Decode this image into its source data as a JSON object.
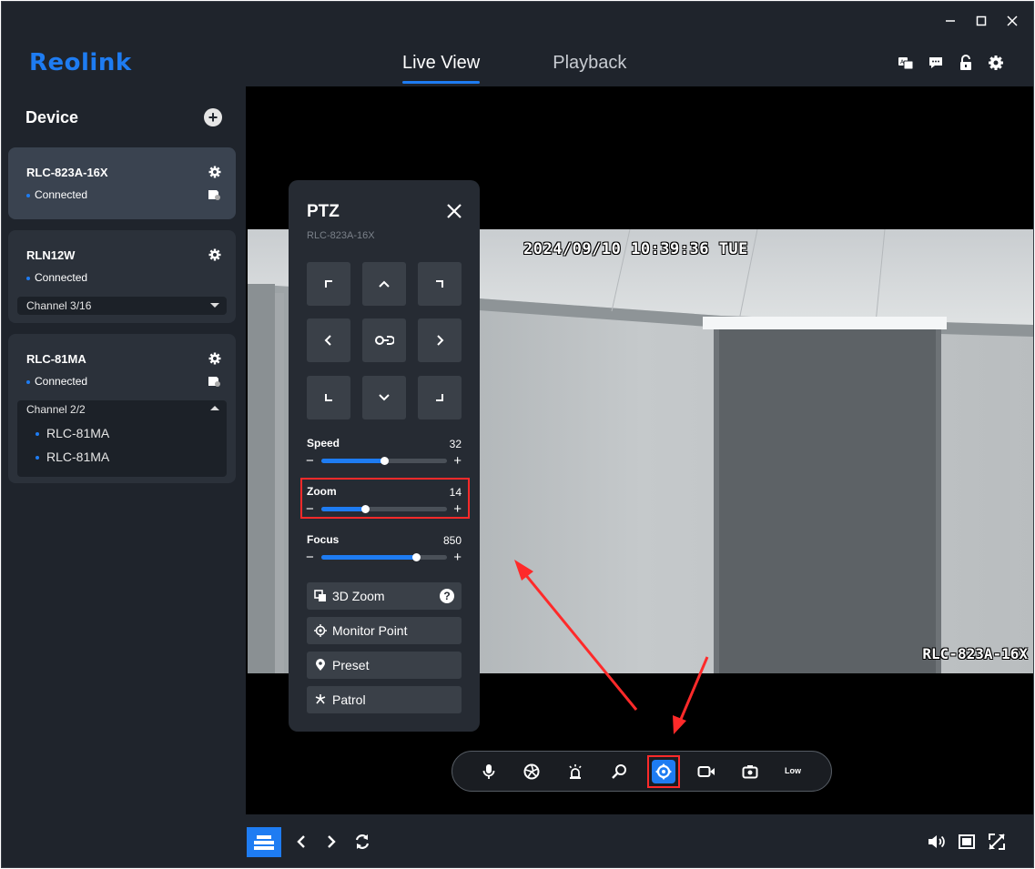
{
  "header": {
    "logo": "Reolink",
    "tabs": [
      {
        "label": "Live View",
        "active": true
      },
      {
        "label": "Playback",
        "active": false
      }
    ],
    "window_controls": [
      "minimize-icon",
      "maximize-icon",
      "close-icon"
    ],
    "icons": [
      "translate-icon",
      "message-icon",
      "unlock-icon",
      "gear-icon"
    ]
  },
  "sidebar": {
    "title": "Device",
    "devices": [
      {
        "name": "RLC-823A-16X",
        "status": "Connected",
        "active": true
      },
      {
        "name": "RLN12W",
        "status": "Connected",
        "channel": "Channel 3/16"
      },
      {
        "name": "RLC-81MA",
        "status": "Connected",
        "channel": "Channel 2/2",
        "channels": [
          "RLC-81MA",
          "RLC-81MA"
        ]
      }
    ]
  },
  "video": {
    "timestamp": "2024/09/10 10:39:36 TUE",
    "camera_name": "RLC-823A-16X"
  },
  "ptz": {
    "title": "PTZ",
    "device": "RLC-823A-16X",
    "speed": {
      "label": "Speed",
      "value": "32",
      "fraction": 0.5
    },
    "zoom": {
      "label": "Zoom",
      "value": "14",
      "fraction": 0.35
    },
    "focus": {
      "label": "Focus",
      "value": "850",
      "fraction": 0.75
    },
    "buttons": {
      "zoom3d": "3D Zoom",
      "monitor": "Monitor Point",
      "preset": "Preset",
      "patrol": "Patrol"
    }
  },
  "controls": {
    "stream": "Low"
  },
  "colors": {
    "accent": "#1e7cf2",
    "highlight": "#ff2a2a",
    "background": "#1f242c"
  }
}
